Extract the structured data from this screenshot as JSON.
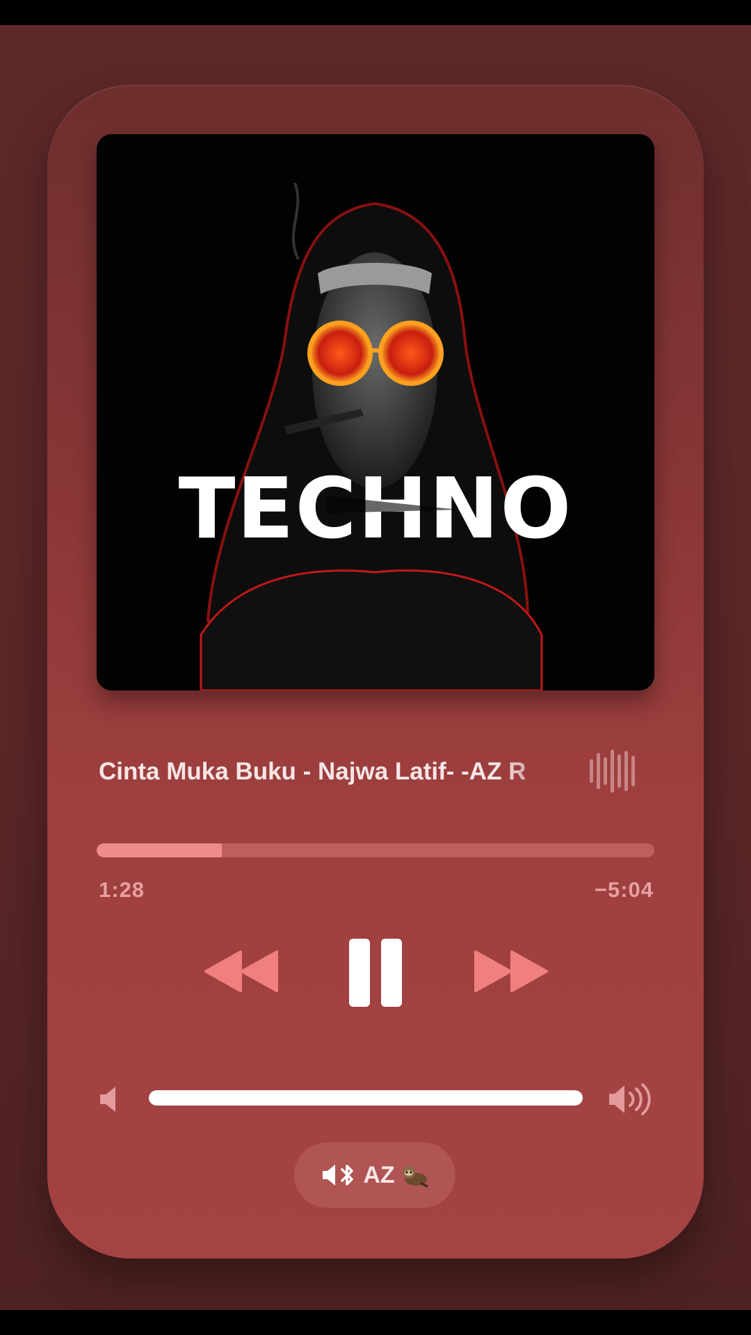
{
  "player": {
    "artwork_text": "TECHNO",
    "track_title": "Cinta Muka Buku - Najwa Latif- -AZ R",
    "progress_fraction": 0.224,
    "time_elapsed": "1:28",
    "time_remaining": "−5:04",
    "volume_fraction": 1.0,
    "controls": {
      "rewind_icon": "rewind-icon",
      "pause_icon": "pause-icon",
      "forward_icon": "fast-forward-icon"
    },
    "output": {
      "label": "AZ",
      "icon": "speaker-bluetooth-icon"
    }
  },
  "colors": {
    "accent": "#f08080",
    "progress_fill": "#ee8c8c",
    "text": "#f7e6e6"
  }
}
